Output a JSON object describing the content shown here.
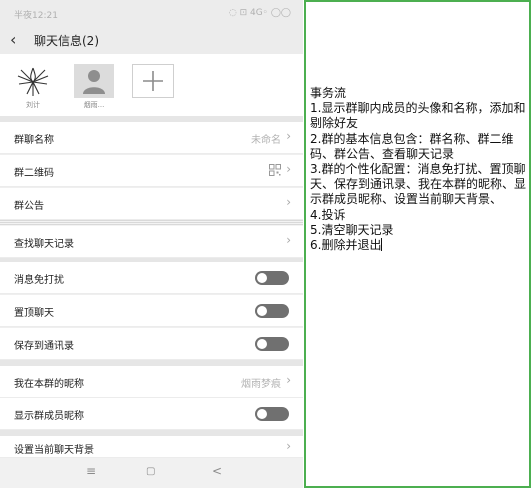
{
  "status_bar": {
    "time": "半夜12:21",
    "right": "◌ ⊡ 4G◦ ◯◯"
  },
  "header": {
    "title": "聊天信息(2)",
    "back_icon": "back-arrow-icon"
  },
  "members": [
    {
      "name": "刘计",
      "avatar": "stylized-figure-avatar"
    },
    {
      "name": "烟雨...",
      "avatar": "default-user-avatar"
    }
  ],
  "add_member_icon": "plus-icon",
  "settings": {
    "group_name": {
      "label": "群聊名称",
      "value": "未命名"
    },
    "qr_code": {
      "label": "群二维码",
      "icon": "qr-code-icon"
    },
    "announcement": {
      "label": "群公告"
    },
    "search_history": {
      "label": "查找聊天记录"
    },
    "mute": {
      "label": "消息免打扰",
      "on": false
    },
    "pin": {
      "label": "置顶聊天",
      "on": false
    },
    "save_contacts": {
      "label": "保存到通讯录",
      "on": false
    },
    "nickname": {
      "label": "我在本群的昵称",
      "value": "烟雨梦痕"
    },
    "show_nicknames": {
      "label": "显示群成员昵称",
      "on": false
    },
    "background": {
      "label": "设置当前聊天背景"
    }
  },
  "bottom_nav": {
    "menu": "≡",
    "home": "▢",
    "back": "<"
  },
  "notes": {
    "text": "事务流\n1.显示群聊内成员的头像和名称，添加和剔除好友\n2.群的基本信息包含：群名称、群二维码、群公告、查看聊天记录\n3.群的个性化配置：消息免打扰、置顶聊天、保存到通讯录、我在本群的昵称、显示群成员昵称、设置当前聊天背景、\n4.投诉\n5.清空聊天记录\n6.删除并退出"
  },
  "colors": {
    "notes_border": "#4caf50",
    "toggle_off": "#707070",
    "background": "#efefef"
  }
}
